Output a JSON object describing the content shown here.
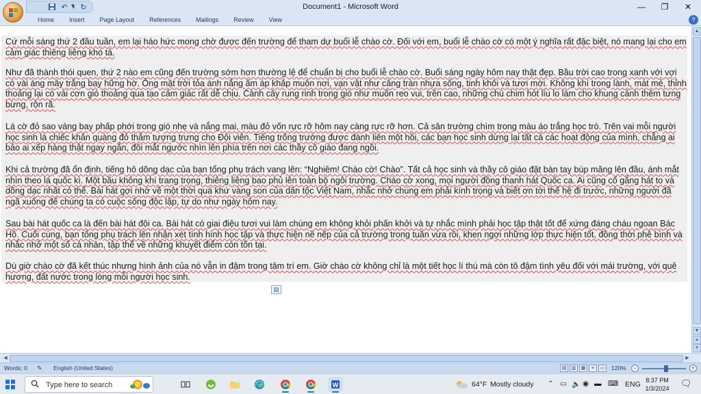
{
  "window": {
    "title": "Document1 - Microsoft Word",
    "controls": {
      "minimize": "—",
      "maximize": "❐",
      "close": "✕"
    }
  },
  "ribbon": {
    "tabs": [
      "Home",
      "Insert",
      "Page Layout",
      "References",
      "Mailings",
      "Review",
      "View"
    ],
    "help": "?"
  },
  "document": {
    "paragraphs": [
      "Cứ mỗi sáng thứ 2 đầu tuần, em lại háo hức mong chờ được đến trường để tham dự buổi lễ chào cờ. Đối với em, buổi lễ chào cờ có một ý nghĩa rất đặc biệt, nó mang lại cho em cảm giác thiêng liêng khó tả.",
      "Như đã thành thói quen, thứ 2 nào em cũng đến trường sớm hơn thường lệ để chuẩn bị cho buổi lễ chào cờ. Buổi sáng ngày hôm nay thật đẹp. Bầu trời cao trong xanh với vợi có vài áng mây trắng bay hững hờ. Ông mặt trời tỏa ánh nắng ấm áp khắp muôn nơi, vạn vật như căng tràn nhựa sống, tinh khôi và tươi mới. Không khí trong lành, mát mẻ, thỉnh thoảng lại có vài cơn gió thoảng qua tạo cảm giác rất dễ chịu. Cành cây rung rinh trong gió như muốn reo vui, trên cao, những chú chim hót líu lo làm cho khung cảnh thêm tưng bừng, rộn rã.",
      "Lá cờ đỏ sao vàng bay phấp phới trong gió nhẹ và nắng mai, màu đỏ vốn rực rỡ hôm nay càng rực rỡ hơn. Cả sân trường chìm trong màu áo trắng học trò. Trên vai mỗi người học sinh là chiếc khăn quàng đỏ thắm tượng trưng cho Đội viên. Tiếng trống trường được đánh liên một hồi, các bạn học sinh dừng lại tất cả các hoạt động của mình, chẳng ai bảo ai xếp hàng thật ngay ngắn, đôi mắt ngước nhìn lên phía trên nơi các thầy cô giáo đang ngồi.",
      "Khi cả trường đã ổn định, tiếng hô dõng dạc của bạn tổng phụ trách vang lên: “Nghiêm! Chào cờ! Chào”. Tất cả học sinh và thầy cô giáo đặt bàn tay búp măng lên đầu, ánh mắt nhìn theo lá quốc kì. Một bầu không khí trang trọng, thiêng liêng bao phủ lên toàn bộ ngôi trường. Chào cờ xong, mọi người đồng thanh hát Quốc ca. Ai cũng cố gắng hát to và dõng dạc nhất có thể. Bài hát gợi nhớ về một thời quá khứ vàng son của dân tộc Việt Nam, nhắc nhở chúng em phải kính trọng và biết ơn tới thế hệ đi trước, những người đã ngã xuống để chúng ta có cuộc sống độc lập, tự do như ngày hôm nay.",
      "Sau bài hát quốc ca là đến bài hát đội ca. Bài hát có giai điệu tươi vui làm chúng em không khỏi phấn khởi và tự nhắc mình phải học tập thật tốt để xứng đáng cháu ngoan Bác Hồ. Cuối cùng, bạn tổng phụ trách lên nhận xét tình hình học tập và thực hiện nề nếp của cả trường trong tuần vừa rồi, khen ngợi những lớp thực hiện tốt, đồng thời phê bình và nhắc nhở một số cá nhân, tập thể về những khuyết điểm còn tồn tại.",
      "Dù giờ chào cờ đã kết thúc nhưng hình ảnh của nó vẫn in đậm trong tâm trí em. Giờ chào cờ không chỉ là một tiết học lí thú mà còn tô đậm tình yêu đối với mái trường, với quê hương, đất nước trong lòng mỗi người học sinh."
    ]
  },
  "statusbar": {
    "words": "Words: 0",
    "language": "English (United States)",
    "zoom": "120%",
    "zoom_minus": "−",
    "zoom_plus": "+",
    "zoom_level": 0.55
  },
  "taskbar": {
    "search_placeholder": "Type here to search",
    "weather": "64°F",
    "weather_desc": "Mostly cloudy",
    "input_lang": "ENG",
    "time": "8:37 PM",
    "date": "1/3/2024"
  },
  "colors": {
    "ribbon_bg": "#dbe6f4",
    "spellcheck": "#e04a4a",
    "taskbar_bg": "#e6ebf2",
    "accent": "#1a73d9"
  }
}
